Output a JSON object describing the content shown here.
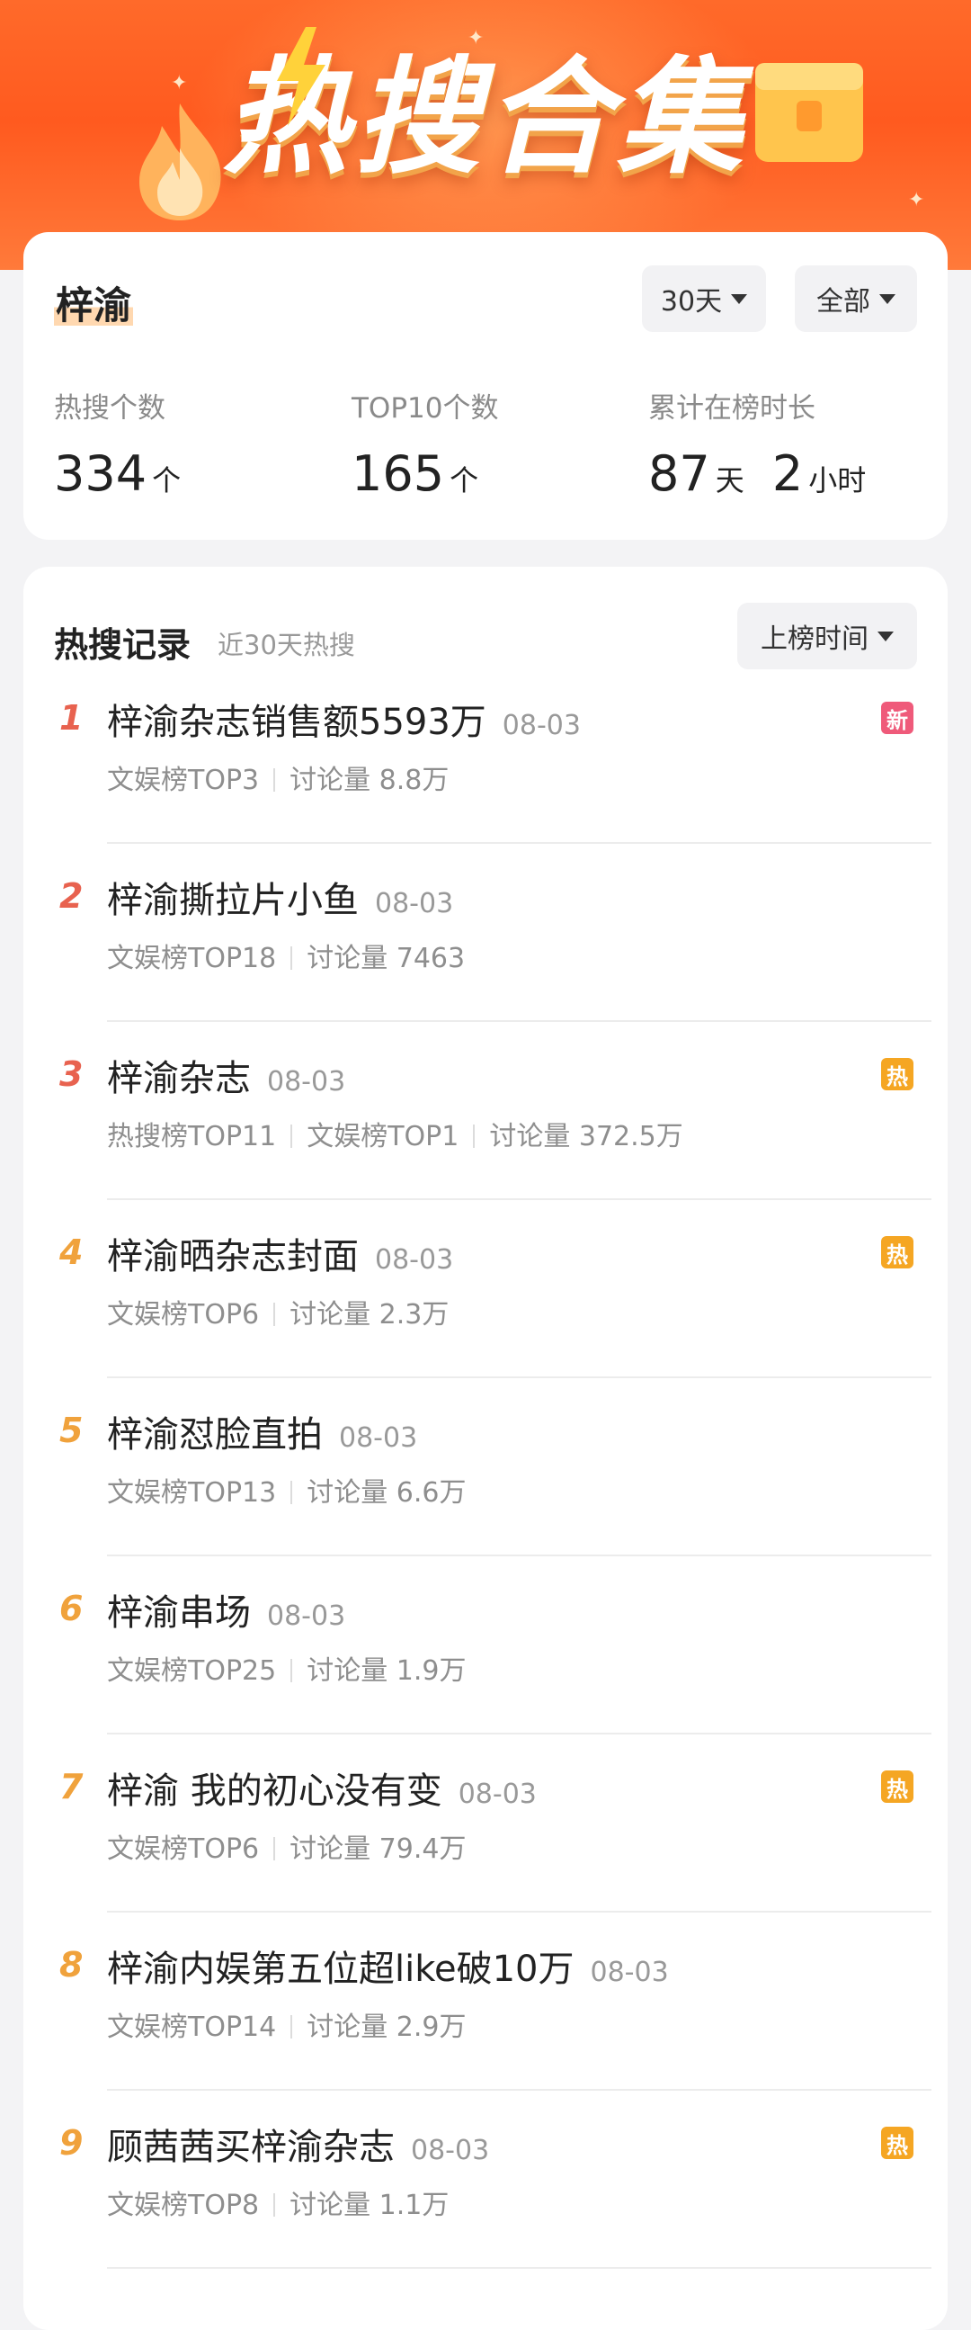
{
  "banner": {
    "title": "热搜合集"
  },
  "summary": {
    "name": "梓渝",
    "days_filter": "30天",
    "scope_filter": "全部",
    "stats": [
      {
        "label": "热搜个数",
        "value": "334",
        "unit": "个"
      },
      {
        "label": "TOP10个数",
        "value": "165",
        "unit": "个"
      },
      {
        "label": "累计在榜时长",
        "value_days": "87",
        "unit_days": "天",
        "value_hours": "2",
        "unit_hours": "小时"
      }
    ]
  },
  "records": {
    "title": "热搜记录",
    "subtitle": "近30天热搜",
    "sort_label": "上榜时间",
    "items": [
      {
        "rank": "1",
        "title": "梓渝杂志销售额5593万",
        "date": "08-03",
        "meta": [
          "文娱榜TOP3",
          "讨论量 8.8万"
        ],
        "badge": "新"
      },
      {
        "rank": "2",
        "title": "梓渝撕拉片小鱼",
        "date": "08-03",
        "meta": [
          "文娱榜TOP18",
          "讨论量 7463"
        ],
        "badge": ""
      },
      {
        "rank": "3",
        "title": "梓渝杂志",
        "date": "08-03",
        "meta": [
          "热搜榜TOP11",
          "文娱榜TOP1",
          "讨论量 372.5万"
        ],
        "badge": "热"
      },
      {
        "rank": "4",
        "title": "梓渝晒杂志封面",
        "date": "08-03",
        "meta": [
          "文娱榜TOP6",
          "讨论量 2.3万"
        ],
        "badge": "热"
      },
      {
        "rank": "5",
        "title": "梓渝怼脸直拍",
        "date": "08-03",
        "meta": [
          "文娱榜TOP13",
          "讨论量 6.6万"
        ],
        "badge": ""
      },
      {
        "rank": "6",
        "title": "梓渝串场",
        "date": "08-03",
        "meta": [
          "文娱榜TOP25",
          "讨论量 1.9万"
        ],
        "badge": ""
      },
      {
        "rank": "7",
        "title": "梓渝 我的初心没有变",
        "date": "08-03",
        "meta": [
          "文娱榜TOP6",
          "讨论量 79.4万"
        ],
        "badge": "热"
      },
      {
        "rank": "8",
        "title": "梓渝内娱第五位超like破10万",
        "date": "08-03",
        "meta": [
          "文娱榜TOP14",
          "讨论量 2.9万"
        ],
        "badge": ""
      },
      {
        "rank": "9",
        "title": "顾茜茜买梓渝杂志",
        "date": "08-03",
        "meta": [
          "文娱榜TOP8",
          "讨论量 1.1万"
        ],
        "badge": "热"
      }
    ]
  },
  "colors": {
    "rank_top3": "#e8624f",
    "rank_other": "#f0a23c",
    "badge_new": "#ef5a7a",
    "badge_hot": "#f5a623"
  }
}
